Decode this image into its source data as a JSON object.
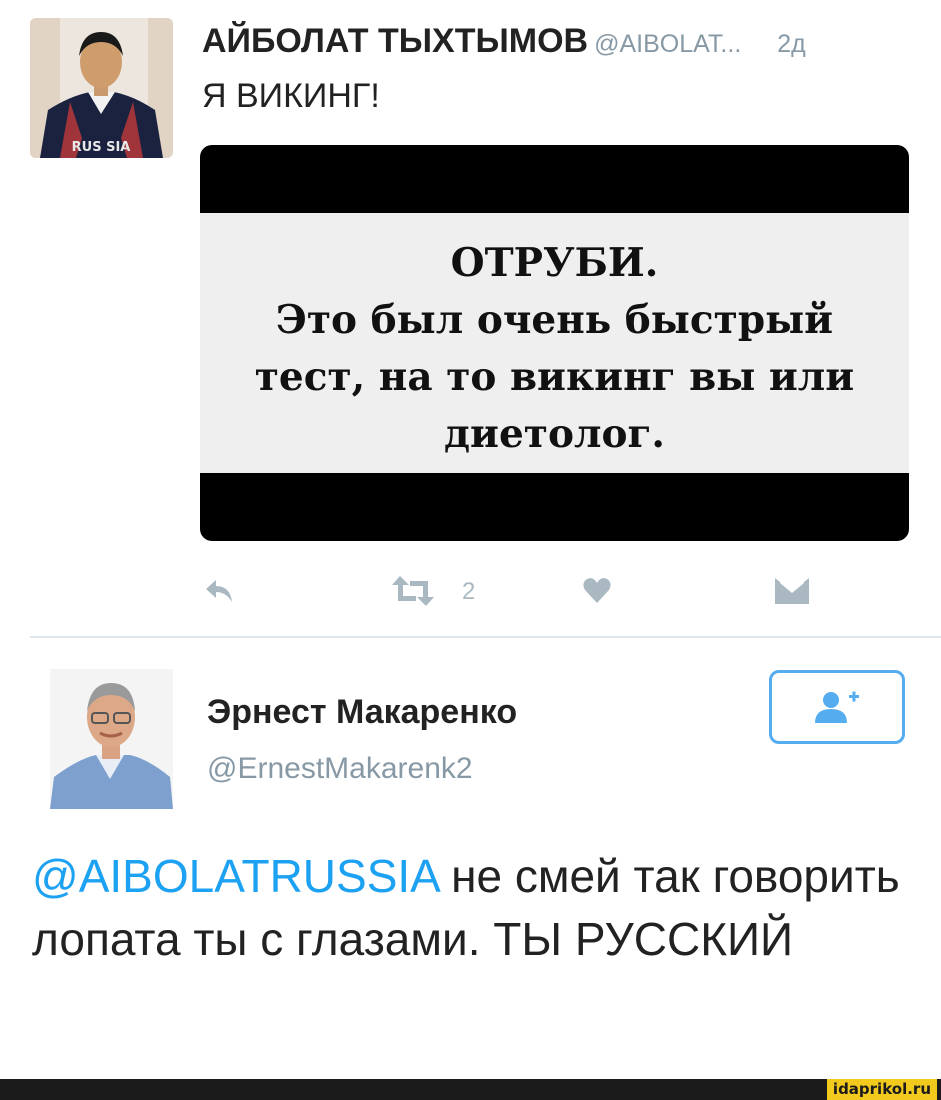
{
  "tweet1": {
    "name": "АЙБОЛАТ ТЫХТЫМОВ",
    "handle": "@AIBOLAT...",
    "time": "2д",
    "text": "Я ВИКИНГ!",
    "avatar_jacket_text": "RUS SIA",
    "media": {
      "lines": [
        "ОТРУБИ.",
        "Это был очень быстрый",
        "тест, на то викинг вы или",
        "диетолог."
      ]
    },
    "actions": {
      "reply_icon": "reply-icon",
      "retweet_icon": "retweet-icon",
      "retweet_count": "2",
      "like_icon": "heart-icon",
      "dm_icon": "envelope-icon"
    }
  },
  "tweet2": {
    "name": "Эрнест Макаренко",
    "handle": "@ErnestMakarenk2",
    "mention": "@AIBOLATRUSSIA",
    "text": " не смей так говорить лопата ты с глазами.  ТЫ РУССКИЙ",
    "follow_icon": "add-user-icon"
  },
  "watermark": "idaprikol.ru",
  "colors": {
    "accent": "#1da1f2",
    "secondary_text": "#8899a6",
    "icon_gray": "#aab8c2",
    "watermark_bg": "#f2ca1e"
  }
}
